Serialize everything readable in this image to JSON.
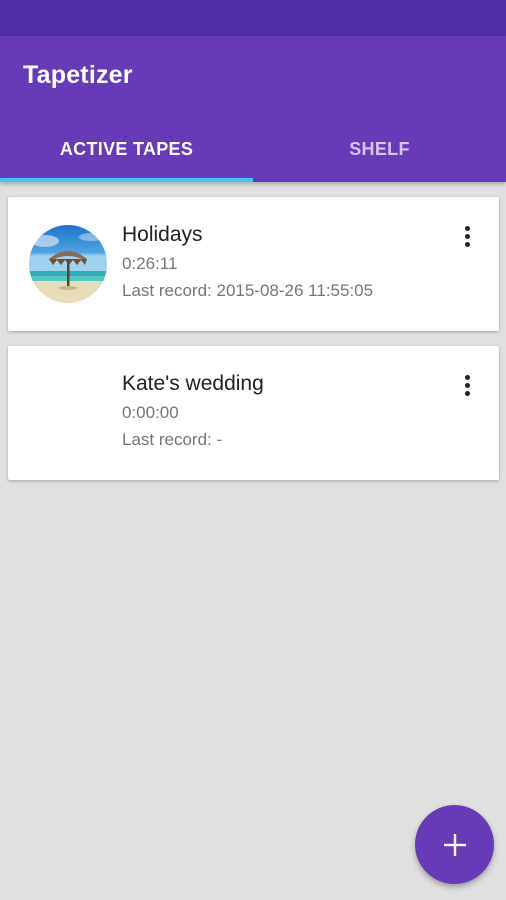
{
  "app": {
    "title": "Tapetizer"
  },
  "tabs": [
    {
      "label": "ACTIVE TAPES",
      "active": true
    },
    {
      "label": "SHELF",
      "active": false
    }
  ],
  "tapes": [
    {
      "title": "Holidays",
      "duration": "0:26:11",
      "last_record": "Last record: 2015-08-26 11:55:05",
      "has_thumbnail": true,
      "thumbnail": "beach-umbrella-photo"
    },
    {
      "title": "Kate's wedding",
      "duration": "0:00:00",
      "last_record": "Last record: -",
      "has_thumbnail": false
    }
  ],
  "fab": {
    "icon": "plus-icon"
  },
  "colors": {
    "primary": "#673ab7",
    "primary_dark": "#512da8",
    "tab_indicator": "#40c4ff",
    "background": "#e0e0e0"
  },
  "icons": {
    "more": "more-vert-icon",
    "add": "plus-icon"
  }
}
